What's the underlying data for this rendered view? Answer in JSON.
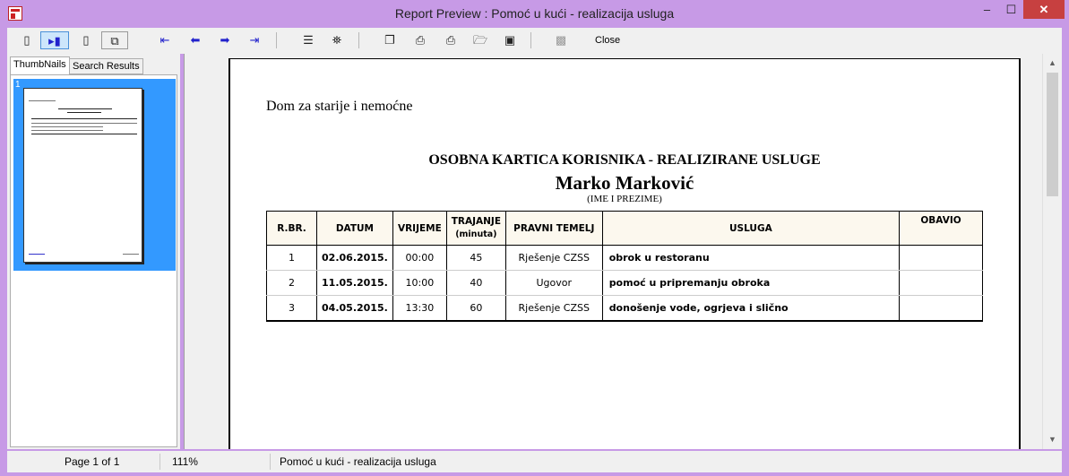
{
  "window": {
    "title": "Report Preview : Pomoć u kući - realizacija usluga",
    "min": "–",
    "max": "☐",
    "close": "✕"
  },
  "toolbar": {
    "close_label": "Close"
  },
  "tabs": [
    {
      "label": "ThumbNails"
    },
    {
      "label": "Search Results"
    }
  ],
  "thumbnails": [
    {
      "page": "1"
    }
  ],
  "report": {
    "org": "Dom za starije i nemoćne",
    "title": "OSOBNA KARTICA KORISNIKA - REALIZIRANE USLUGE",
    "person": "Marko Marković",
    "person_caption": "(IME I PREZIME)",
    "columns": [
      "R.BR.",
      "DATUM",
      "VRIJEME",
      "TRAJANJE",
      "(minuta)",
      "PRAVNI TEMELJ",
      "USLUGA",
      "OBAVIO"
    ],
    "rows": [
      {
        "rbr": "1",
        "datum": "02.06.2015.",
        "vrijeme": "00:00",
        "trajanje": "45",
        "temelj": "Rješenje CZSS",
        "usluga": "obrok u restoranu",
        "obavio": ""
      },
      {
        "rbr": "2",
        "datum": "11.05.2015.",
        "vrijeme": "10:00",
        "trajanje": "40",
        "temelj": "Ugovor",
        "usluga": "pomoć u pripremanju obroka",
        "obavio": ""
      },
      {
        "rbr": "3",
        "datum": "04.05.2015.",
        "vrijeme": "13:30",
        "trajanje": "60",
        "temelj": "Rješenje CZSS",
        "usluga": "donošenje vode, ogrjeva i slično",
        "obavio": ""
      }
    ]
  },
  "status": {
    "page": "Page 1 of 1",
    "zoom": "111%",
    "report_name": "Pomoć u kući - realizacija usluga"
  }
}
